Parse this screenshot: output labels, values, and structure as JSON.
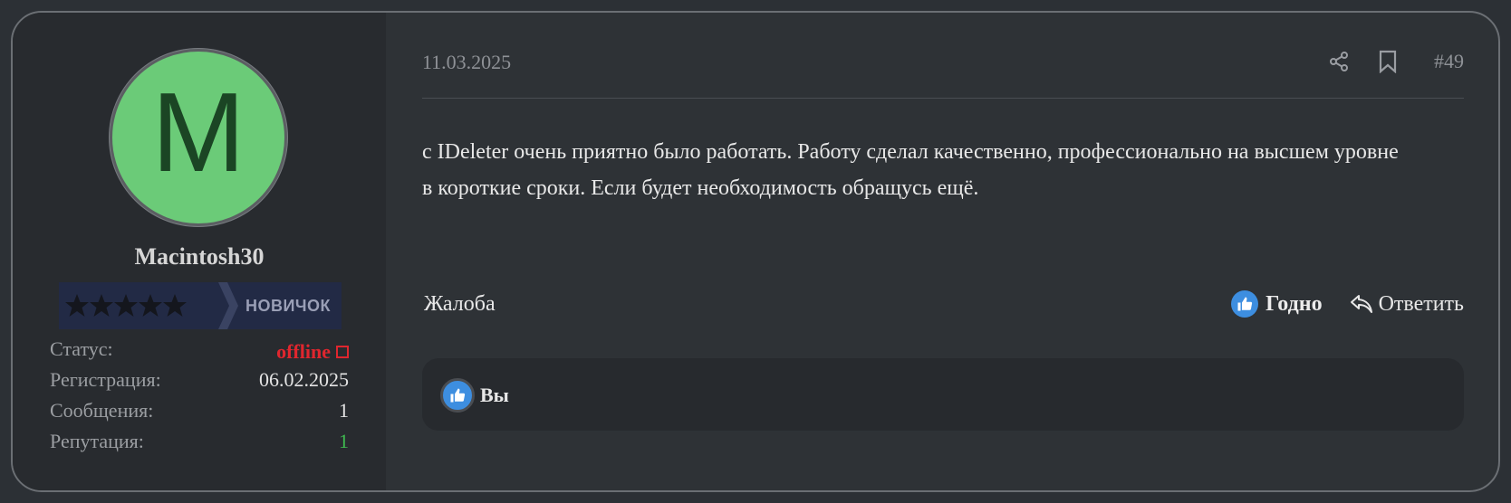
{
  "user": {
    "avatar_letter": "M",
    "avatar_color": "#6bcb78",
    "username": "Macintosh30",
    "rank": {
      "label": "НОВИЧОК",
      "stars": 5
    },
    "stats": {
      "status_label": "Статус:",
      "status_value": "offline",
      "registration_label": "Регистрация:",
      "registration_value": "06.02.2025",
      "messages_label": "Сообщения:",
      "messages_value": "1",
      "reputation_label": "Репутация:",
      "reputation_value": "1"
    }
  },
  "post": {
    "date": "11.03.2025",
    "number": "#49",
    "header_icons": [
      "share-icon",
      "bookmark-icon"
    ],
    "message": "с IDeleter очень приятно было работать. Работу сделал качественно, профессионально на высшем уровне в короткие сроки. Если будет необходимость обращусь ещё.",
    "complaint_label": "Жалоба",
    "like_label": "Годно",
    "reply_label": "Ответить",
    "likes": {
      "user": "Вы"
    }
  },
  "colors": {
    "accent_like": "#3d8ee0",
    "offline": "#e0262e",
    "reputation_positive": "#3fb950"
  }
}
